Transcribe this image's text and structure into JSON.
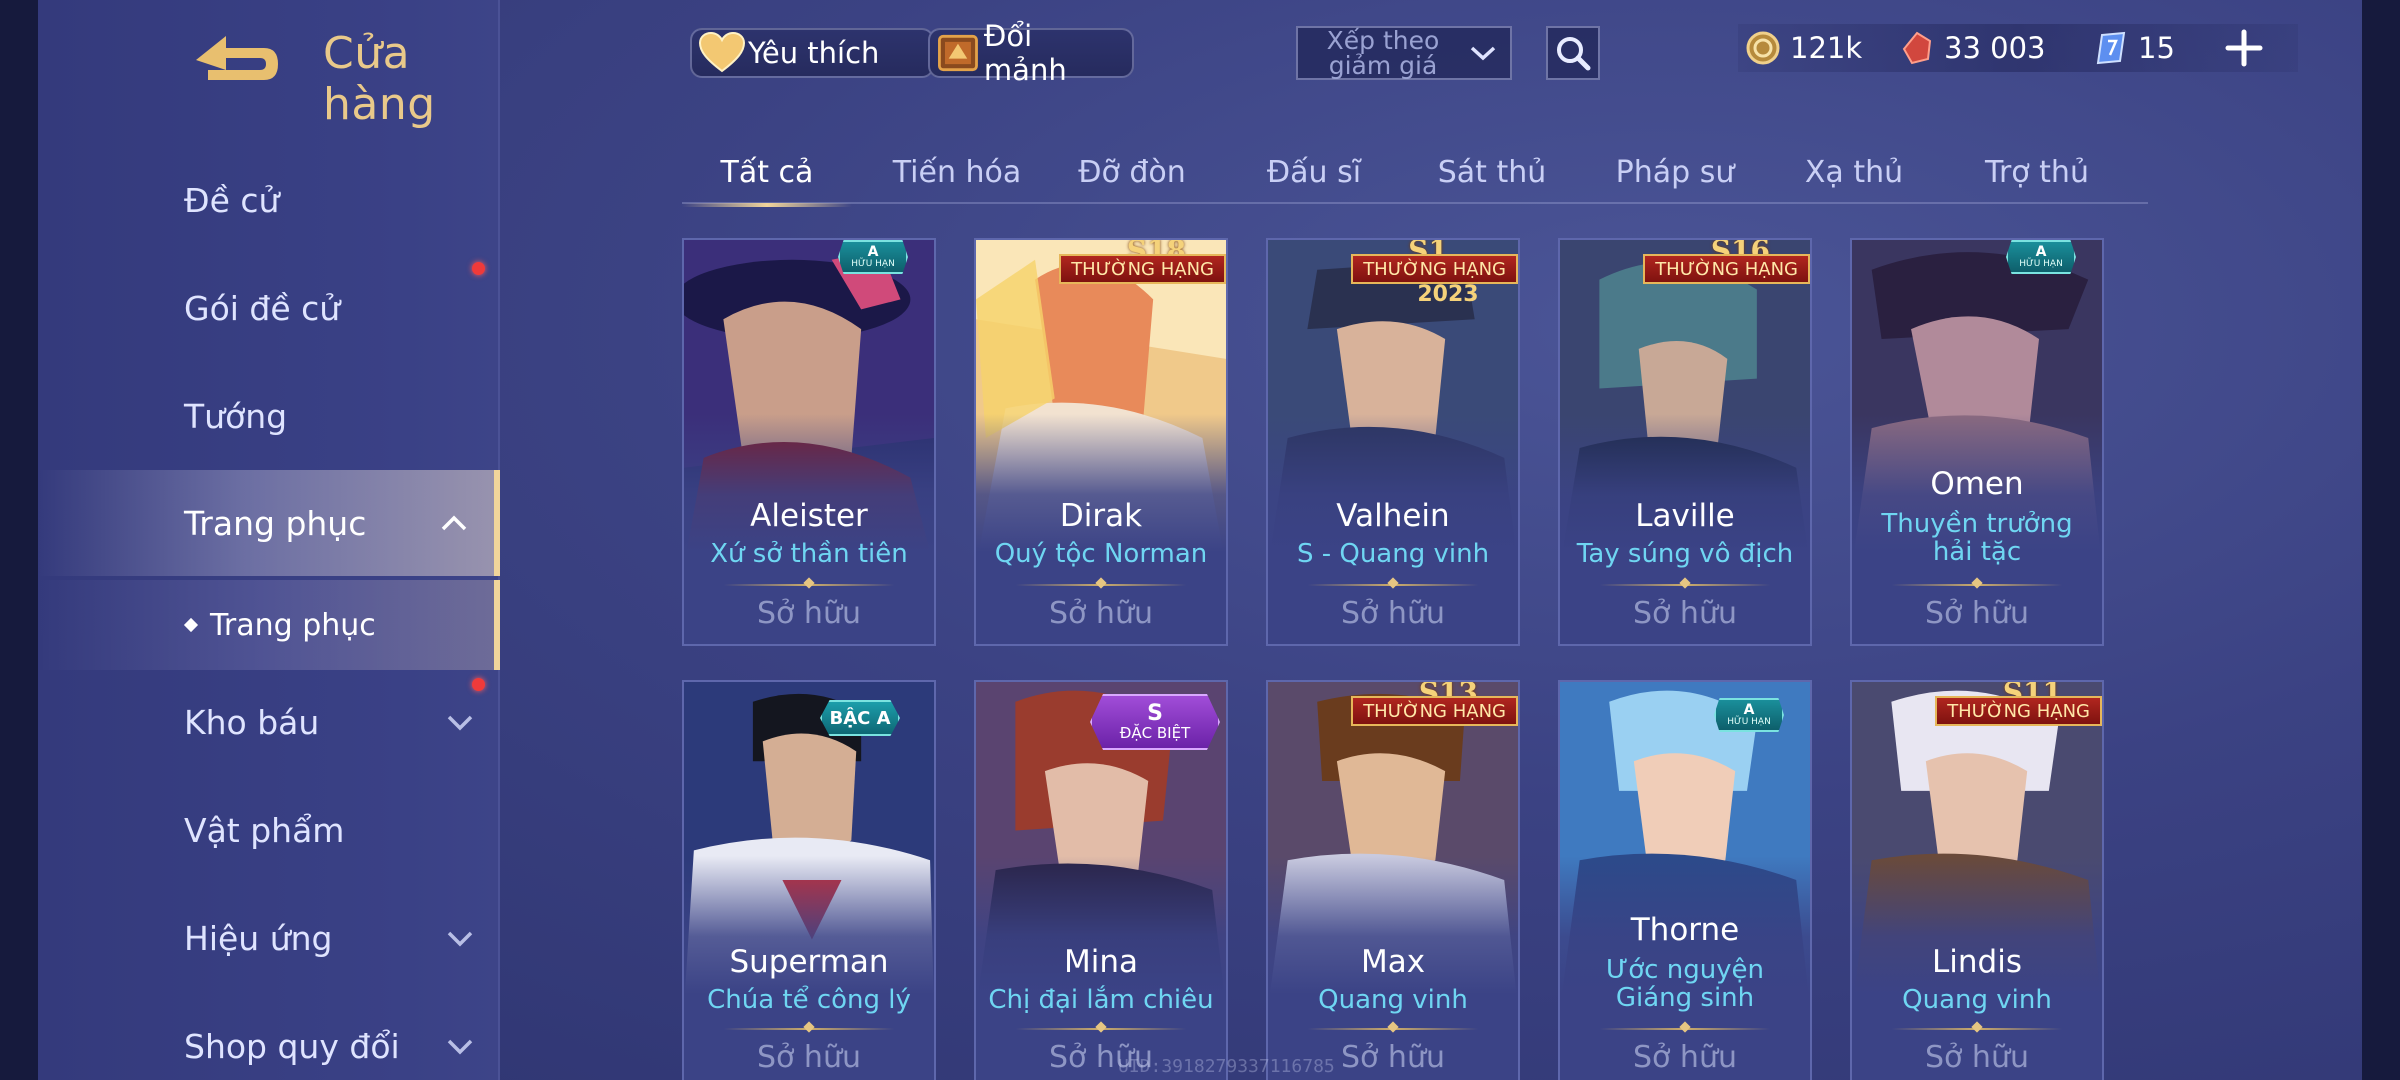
{
  "header": {
    "title": "Cửa hàng",
    "favorite_label": "Yêu thích",
    "exchange_label": "Đổi mảnh",
    "sort_label": "Xếp theo giảm giá"
  },
  "currencies": {
    "gold": "121k",
    "vouchers": "33 003",
    "gems": "15"
  },
  "sidebar": {
    "items": [
      {
        "label": "Đề cử"
      },
      {
        "label": "Gói đề cử"
      },
      {
        "label": "Tướng"
      },
      {
        "label": "Trang phục"
      },
      {
        "label": "Trang phục"
      },
      {
        "label": "Kho báu"
      },
      {
        "label": "Vật phẩm"
      },
      {
        "label": "Hiệu ứng"
      },
      {
        "label": "Shop quy đổi"
      }
    ]
  },
  "tabs": [
    "Tất cả",
    "Tiến hóa",
    "Đỡ đòn",
    "Đấu sĩ",
    "Sát thủ",
    "Pháp sư",
    "Xạ thủ",
    "Trợ thủ"
  ],
  "owned_label": "Sở hữu",
  "badges": {
    "rank": "THƯỜNG HẠNG",
    "limited": "HỮU HẠN",
    "a_grade": "A",
    "bac_a": "BẬC A",
    "special_s": "S",
    "special": "ĐẶC BIỆT",
    "s18": "S18",
    "s1": "S1",
    "s16": "S16",
    "s13": "S13",
    "s11": "S11",
    "year": "2023"
  },
  "cards": [
    {
      "hero": "Aleister",
      "skin": "Xứ sở thần tiên"
    },
    {
      "hero": "Dirak",
      "skin": "Quý tộc Norman"
    },
    {
      "hero": "Valhein",
      "skin": "S - Quang vinh"
    },
    {
      "hero": "Laville",
      "skin": "Tay súng vô địch"
    },
    {
      "hero": "Omen",
      "skin": "Thuyền trưởng hải tặc"
    },
    {
      "hero": "Superman",
      "skin": "Chúa tể công lý"
    },
    {
      "hero": "Mina",
      "skin": "Chị đại lắm chiêu"
    },
    {
      "hero": "Max",
      "skin": "Quang vinh"
    },
    {
      "hero": "Thorne",
      "skin": "Ước nguyện Giáng sinh"
    },
    {
      "hero": "Lindis",
      "skin": "Quang vinh"
    }
  ],
  "watermark": "UID:3918279337116785",
  "colors": {
    "accent_gold": "#f1d59b",
    "skin_text": "#6fd6f2",
    "background": "#3b4283",
    "badge_red": "#b1261f",
    "badge_teal": "#1a8f9b",
    "notification": "#f03a3a"
  }
}
